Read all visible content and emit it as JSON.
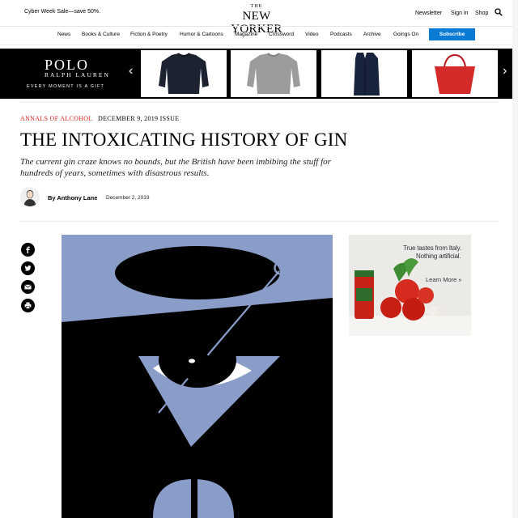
{
  "header": {
    "promo": "Cyber Week Sale—save 50%.",
    "logo_the": "THE",
    "logo_name": "NEW YORKER",
    "links": [
      "Newsletter",
      "Sign in",
      "Shop"
    ]
  },
  "nav": {
    "items": [
      "News",
      "Books & Culture",
      "Fiction & Poetry",
      "Humor & Cartoons",
      "Magazine",
      "Crossword",
      "Video",
      "Podcasts",
      "Archive",
      "Goings On"
    ],
    "subscribe": "Subscribe",
    "accent": "#0a7bd5"
  },
  "ad_banner": {
    "brand_line1": "POLO",
    "brand_line2": "RALPH LAUREN",
    "tagline": "EVERY MOMENT IS A GIFT",
    "products": [
      "navy-crewneck-sweater",
      "grey-cable-knit-sweater",
      "navy-overcoat",
      "red-leather-tote"
    ]
  },
  "article": {
    "rubric": "ANNALS OF ALCOHOL",
    "issue": "DECEMBER 9, 2019 ISSUE",
    "headline": "THE INTOXICATING HISTORY OF GIN",
    "dek": "The current gin craze knows no bounds, but the British have been imbibing the stuff for hundreds of years, sometimes with disastrous results.",
    "byline": "By Anthony Lane",
    "date": "December 2, 2019",
    "rubric_color": "#d0261e"
  },
  "share": [
    "facebook-icon",
    "twitter-icon",
    "email-icon",
    "print-icon"
  ],
  "side_ad": {
    "line1": "True tastes from Italy.",
    "line2": "Nothing artificial.",
    "cta": "Learn More »"
  }
}
